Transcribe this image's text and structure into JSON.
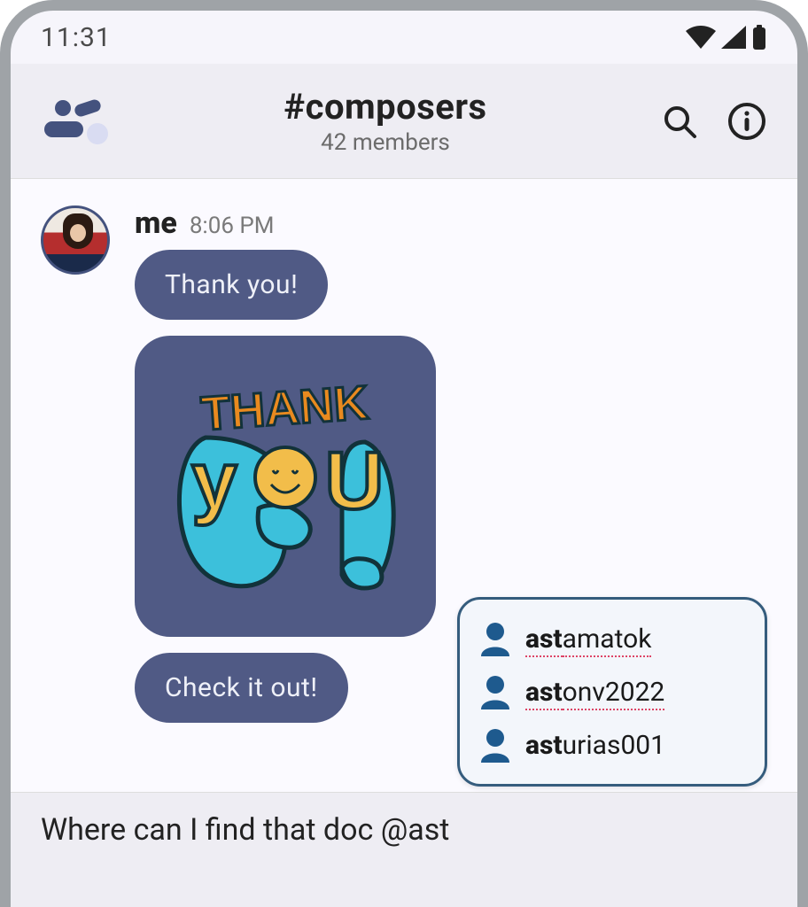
{
  "status": {
    "time": "11:31"
  },
  "header": {
    "channel_name": "#composers",
    "members_text": "42 members"
  },
  "message": {
    "author": "me",
    "timestamp": "8:06 PM",
    "bubble1": "Thank you!",
    "bubble2": "Check it out!",
    "sticker_text_top": "THANK",
    "sticker_text_bottom": "YOU"
  },
  "mentions": {
    "query": "ast",
    "suggestions": [
      {
        "match": "ast",
        "rest": "amatok",
        "spellcheck": true
      },
      {
        "match": "ast",
        "rest": "onv2022",
        "spellcheck": true
      },
      {
        "match": "ast",
        "rest": "urias001",
        "spellcheck": false
      }
    ]
  },
  "composer": {
    "draft": "Where can I find that doc @ast"
  }
}
